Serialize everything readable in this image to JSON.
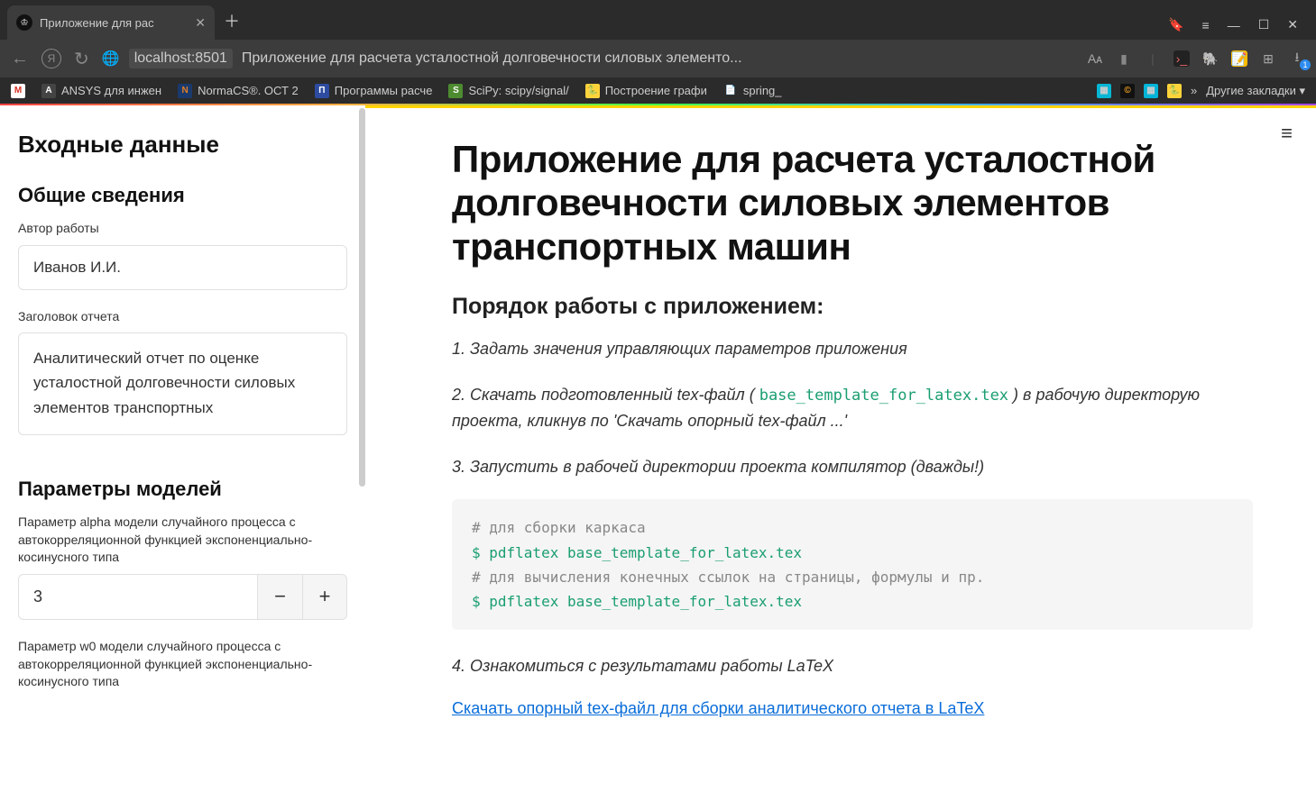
{
  "browser": {
    "tab_title": "Приложение для рас",
    "url_host": "localhost:8501",
    "page_title_in_bar": "Приложение для расчета усталостной долговечности силовых элементо...",
    "other_bookmarks_label": "Другие закладки",
    "bookmarks": [
      {
        "label": "",
        "color": "#d93025",
        "letter": "M"
      },
      {
        "label": "ANSYS для инжен",
        "color": "#555",
        "letter": "A"
      },
      {
        "label": "NormaCS®. ОСТ 2",
        "color": "#e67e22",
        "letter": "N"
      },
      {
        "label": "Программы расче",
        "color": "#2d4ba0",
        "letter": "П"
      },
      {
        "label": "SciPy: scipy/signal/",
        "color": "#4d8b31",
        "letter": "S"
      },
      {
        "label": "Построение графи",
        "color": "#3572A5",
        "letter": "🐍"
      },
      {
        "label": "spring_",
        "color": "#888",
        "letter": "📄"
      }
    ]
  },
  "sidebar": {
    "title": "Входные данные",
    "section_general": "Общие сведения",
    "author_label": "Автор работы",
    "author_value": "Иванов И.И.",
    "report_title_label": "Заголовок отчета",
    "report_title_value": "Аналитический отчет по оценке усталостной долговечности силовых элементов транспортных",
    "section_params": "Параметры моделей",
    "alpha_label": "Параметр alpha модели случайного процесса с автокорреляционной функцией экспоненциально-косинусного типа",
    "alpha_value": "3",
    "w0_label": "Параметр w0 модели случайного процесса с автокорреляционной функцией экспоненциально-косинусного типа"
  },
  "main": {
    "title": "Приложение для расчета усталостной долговечности силовых элементов транспортных машин",
    "workflow_heading": "Порядок работы с приложением:",
    "step1": "1. Задать значения управляющих параметров приложения",
    "step2_pre": "2. Скачать подготовленный tex-файл ( ",
    "step2_code": "base_template_for_latex.tex",
    "step2_post": " ) в рабочую директорую проекта, кликнув по 'Скачать опорный tex-файл ...'",
    "step3": "3. Запустить в рабочей директории проекта компилятор (дважды!)",
    "code": {
      "c1": "# для сборки каркаса",
      "c2": "$ pdflatex base_template_for_latex.tex",
      "c3": "# для вычисления конечных ссылок на страницы, формулы и пр.",
      "c4": "$ pdflatex base_template_for_latex.tex"
    },
    "step4": "4. Ознакомиться с результатами работы LaTeX",
    "download_link": "Скачать опорный tex-файл для сборки аналитического отчета в LaTeX"
  }
}
